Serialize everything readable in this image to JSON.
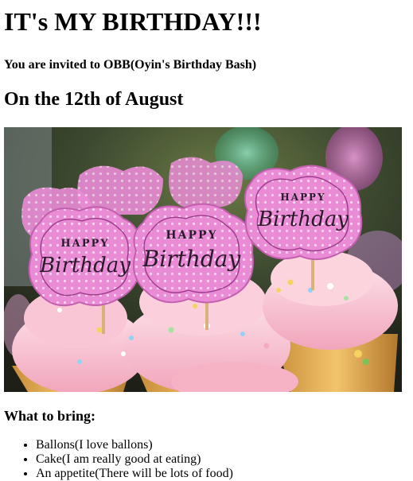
{
  "heading": "IT's MY BIRTHDAY!!!",
  "invite_line": "You are invited to OBB(Oyin's Birthday Bash)",
  "date_line": "On the 12th of August",
  "photo": {
    "topper_text_small": "HAPPY",
    "topper_text_script": "Birthday",
    "colors": {
      "topper_pink": "#e889d6",
      "frosting": "#f7b6c9",
      "background_dark": "#3a3a2a"
    }
  },
  "bring_heading": "What to bring:",
  "bring_items": [
    "Ballons(I love ballons)",
    "Cake(I am really good at eating)",
    "An appetite(There will be lots of food)"
  ]
}
